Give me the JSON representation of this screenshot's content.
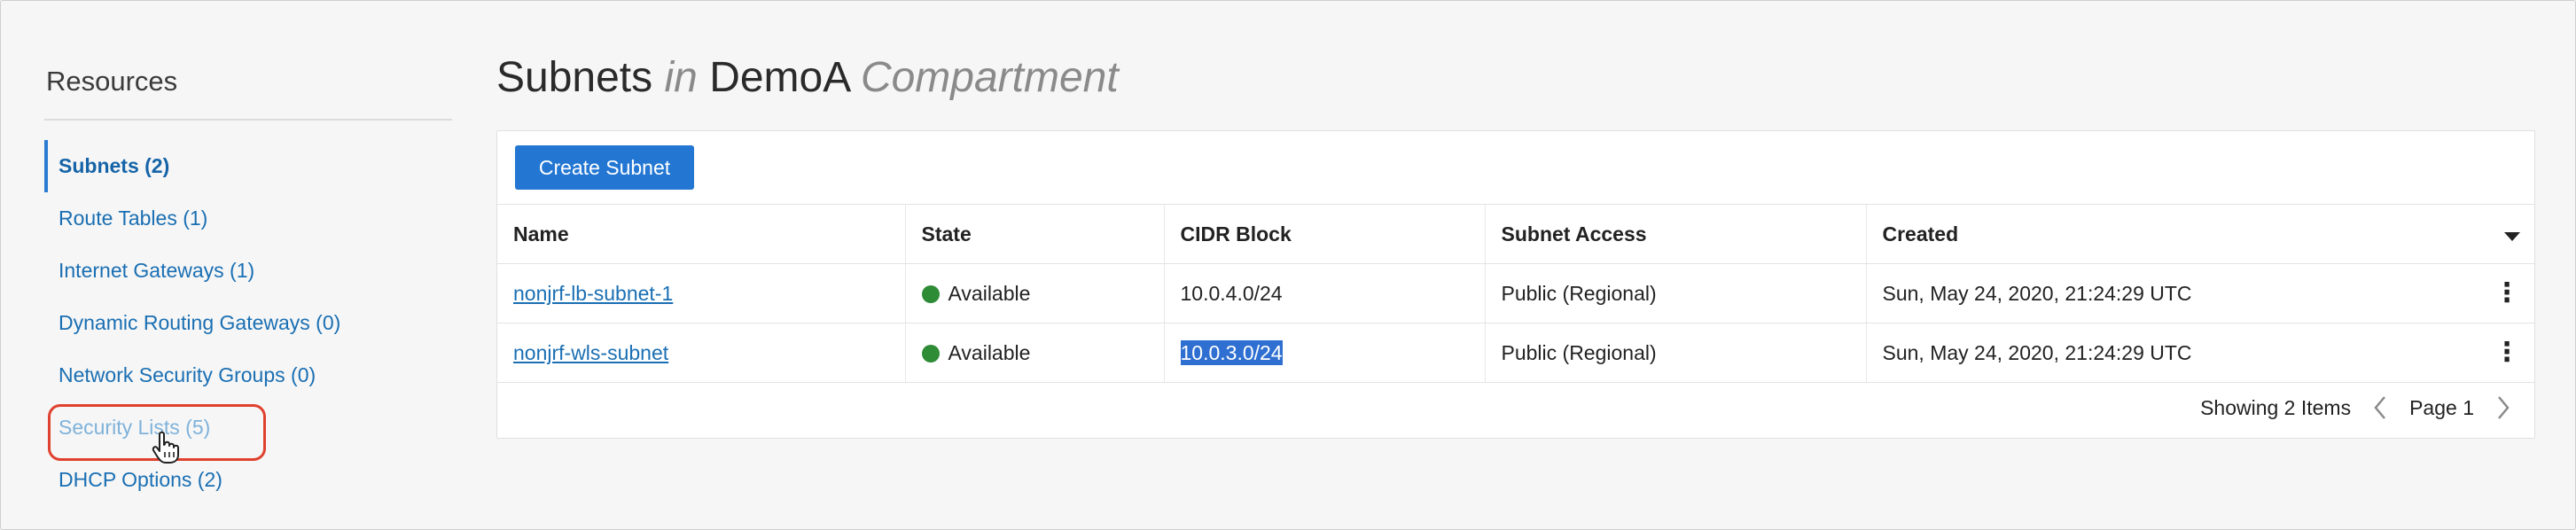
{
  "sidebar": {
    "title": "Resources",
    "items": [
      {
        "label": "Subnets (2)"
      },
      {
        "label": "Route Tables (1)"
      },
      {
        "label": "Internet Gateways (1)"
      },
      {
        "label": "Dynamic Routing Gateways (0)"
      },
      {
        "label": "Network Security Groups (0)"
      },
      {
        "label": "Security Lists (5)"
      },
      {
        "label": "DHCP Options (2)"
      }
    ]
  },
  "header": {
    "title_main": "Subnets",
    "title_in": "in",
    "title_compartment_name": "DemoA",
    "title_compartment_word": "Compartment"
  },
  "toolbar": {
    "create_label": "Create Subnet"
  },
  "table": {
    "columns": [
      "Name",
      "State",
      "CIDR Block",
      "Subnet Access",
      "Created"
    ],
    "rows": [
      {
        "name": "nonjrf-lb-subnet-1",
        "state": "Available",
        "cidr": "10.0.4.0/24",
        "access": "Public (Regional)",
        "created": "Sun, May 24, 2020, 21:24:29 UTC"
      },
      {
        "name": "nonjrf-wls-subnet",
        "state": "Available",
        "cidr": "10.0.3.0/24",
        "access": "Public (Regional)",
        "created": "Sun, May 24, 2020, 21:24:29 UTC"
      }
    ]
  },
  "pagination": {
    "showing": "Showing 2 Items",
    "page": "Page 1"
  },
  "colors": {
    "accent": "#2377d3",
    "link": "#1a6fb3",
    "status_available": "#2e8b36",
    "highlight": "#e0412f"
  },
  "icons": {
    "cursor": "hand-pointer-icon",
    "sort": "caret-down-icon",
    "row_menu": "kebab-menu-icon",
    "prev": "chevron-left-icon",
    "next": "chevron-right-icon",
    "status": "green-dot-icon"
  }
}
